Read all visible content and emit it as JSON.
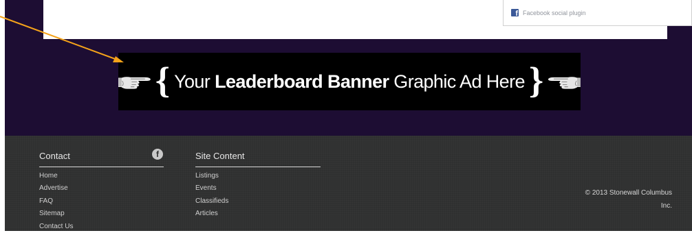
{
  "social_plugin": {
    "icon": "facebook-icon",
    "label": "Facebook social plugin",
    "color": "#3b5998"
  },
  "banner": {
    "text_pre": "Your ",
    "text_strong": "Leaderboard Banner",
    "text_post": " Graphic Ad Here",
    "brace_open": "{",
    "brace_close": "}",
    "left_icon": "pointing-hand-right-icon",
    "right_icon": "pointing-hand-left-icon"
  },
  "annotation": {
    "icon": "orange-arrow-icon",
    "color": "#f5a31a"
  },
  "footer": {
    "contact": {
      "title": "Contact",
      "icon": "facebook-round-icon",
      "links": [
        "Home",
        "Advertise",
        "FAQ",
        "Sitemap",
        "Contact Us"
      ]
    },
    "site_content": {
      "title": "Site Content",
      "links": [
        "Listings",
        "Events",
        "Classifieds",
        "Articles"
      ]
    },
    "copyright_line1": "© 2013 Stonewall Columbus",
    "copyright_line2": "Inc."
  },
  "colors": {
    "page_bg": "#1d0d33",
    "footer_bg": "#2f3030",
    "banner_bg": "#000000"
  }
}
